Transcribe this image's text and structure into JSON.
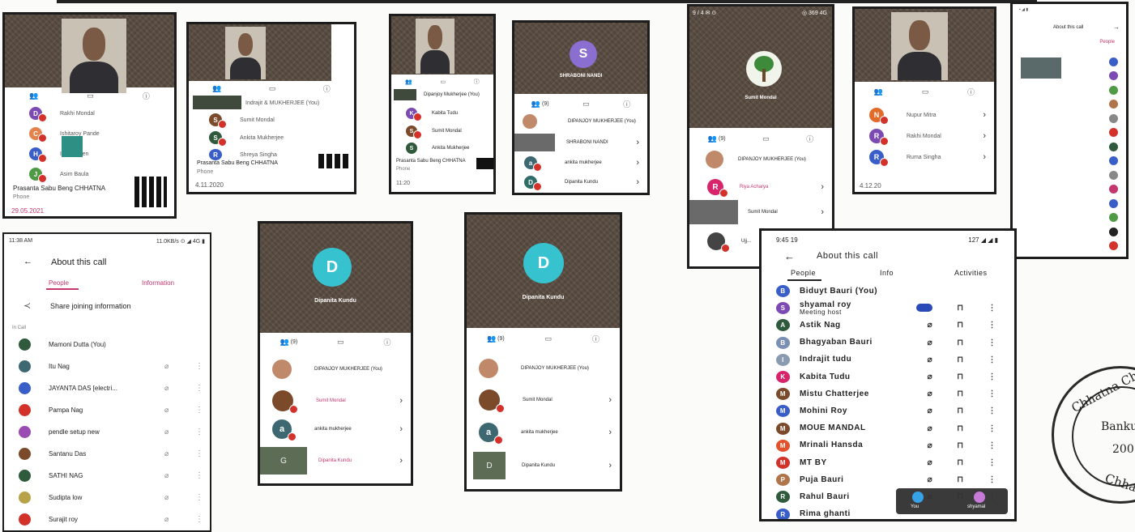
{
  "shot1": {
    "caller": "Prasanta Sabu Beng CHHATNA",
    "type": "Phone",
    "date": "29.05.2021",
    "rows": [
      {
        "name": "Rakhi Mondal",
        "letter": "D",
        "color": "#7b4ab3"
      },
      {
        "name": "Ishitaroy Pande",
        "letter": "C",
        "color": "#e3824a"
      },
      {
        "name": "Indrajit Sen",
        "letter": "H",
        "color": "#3a5ec8"
      },
      {
        "name": "Asim Baula",
        "letter": "J",
        "color": "#4f9a44"
      }
    ]
  },
  "shot2": {
    "caller": "Prasanta Sabu Beng CHHATNA",
    "type": "Phone",
    "date": "4.11.2020",
    "rows": [
      {
        "name": "Indrajit & MUKHERJEE (You)",
        "letter": "",
        "color": "#888"
      },
      {
        "name": "Sumit Mondal",
        "letter": "S",
        "color": "#7a4a2a"
      },
      {
        "name": "Ankita Mukherjee",
        "letter": "S",
        "color": "#2f5a3c"
      },
      {
        "name": "Shreya Singha",
        "letter": "R",
        "color": "#3a5ec8"
      }
    ]
  },
  "shot3": {
    "caller": "Prasanta Sabu Beng CHHATNA",
    "type": "Phone",
    "date": "11:20",
    "rows": [
      {
        "name": "Dipanjoy Mukherjee (You)",
        "letter": "",
        "color": "#888"
      },
      {
        "name": "Kabita Tudu",
        "letter": "K",
        "color": "#7b4ab3"
      },
      {
        "name": "Sumit Mondal",
        "letter": "S",
        "color": "#7a4a2a"
      },
      {
        "name": "Ankita Mukherjee",
        "letter": "S",
        "color": "#2f5a3c"
      }
    ]
  },
  "shot4": {
    "avatar": "S",
    "name": "SHRABONI NANDI",
    "count": "(9)",
    "rows": [
      {
        "name": "DIPANJOY MUKHERJEE (You)",
        "letter": "",
        "color": "#888"
      },
      {
        "name": "SHRABONI NANDI",
        "letter": "",
        "color": "#6a6a6a"
      },
      {
        "name": "ankita mukherjee",
        "letter": "a",
        "color": "#3d6872"
      },
      {
        "name": "Dipanita Kundu",
        "letter": "D",
        "color": "#2e6d6a"
      }
    ]
  },
  "shot5": {
    "status": "9 / 4 ✉ ⊙",
    "status_right": "◎ 369 4G",
    "name": "Sumit Mondal",
    "count": "(9)",
    "rows": [
      {
        "name": "DIPANJOY MUKHERJEE (You)",
        "letter": "",
        "color": "#888"
      },
      {
        "name": "Riya Acharya",
        "letter": "R",
        "color": "#d8246a"
      },
      {
        "name": "Sumit Mondal",
        "letter": "",
        "color": "#6a6a6a"
      },
      {
        "name": "Ujj...",
        "letter": "",
        "color": "#444"
      }
    ]
  },
  "shot6": {
    "date": "4.12.20",
    "rows": [
      {
        "name": "Nupur Mitra",
        "letter": "N",
        "color": "#e36b2a"
      },
      {
        "name": "Rakhi Mondal",
        "letter": "R",
        "color": "#7b4ab3"
      },
      {
        "name": "Ruma Singha",
        "letter": "R",
        "color": "#3a5ec8"
      }
    ]
  },
  "shot7": {
    "title": "About this call",
    "tab": "People",
    "rows": [
      "Biduyt Bauri (You)",
      "shyamal roy",
      "Astik Nag",
      "Bhagyaban Bauri",
      "Indrajit tudu",
      "Kabita Tudu",
      "Mistu Chatterjee",
      "Mohini Roy",
      "MOUE MANDAL",
      "Mrinali Hansda",
      "MT BY",
      "Puja Bauri",
      "Rahul Bauri"
    ]
  },
  "shot8": {
    "status_left": "11:38 AM",
    "status_right": "11.0KB/s ⊙ ◢ 4G ▮",
    "title": "About this call",
    "tab_people": "People",
    "tab_info": "Information",
    "share": "Share joining information",
    "section": "In Call",
    "rows": [
      {
        "name": "Mamoni Dutta (You)",
        "color": "#2f5a3c"
      },
      {
        "name": "Itu Nag",
        "color": "#3d6872"
      },
      {
        "name": "JAYANTA DAS [electri...",
        "color": "#3a5ec8"
      },
      {
        "name": "Pampa Nag",
        "color": "#d3322b"
      },
      {
        "name": "pendle setup new",
        "color": "#9a4ab3"
      },
      {
        "name": "Santanu Das",
        "color": "#7a4a2a"
      },
      {
        "name": "SATHI NAG",
        "color": "#2f5a3c"
      },
      {
        "name": "Sudipta low",
        "color": "#b7a24a"
      },
      {
        "name": "Surajit roy",
        "color": "#d3322b"
      }
    ]
  },
  "shot9": {
    "avatar": "D",
    "name": "Dipanita Kundu",
    "count": "(9)",
    "rows": [
      {
        "name": "DIPANJOY MUKHERJEE (You)",
        "letter": "",
        "color": "#888"
      },
      {
        "name": "Sumit Mondal",
        "letter": "",
        "color": "#7a4a2a"
      },
      {
        "name": "ankita mukherjee",
        "letter": "a",
        "color": "#3d6872"
      },
      {
        "name": "Dipanita Kundu",
        "letter": "G",
        "color": "#5d6d55"
      }
    ]
  },
  "shot10": {
    "avatar": "D",
    "name": "Dipanita Kundu",
    "count": "(9)",
    "rows": [
      {
        "name": "DIPANJOY MUKHERJEE (You)",
        "letter": "",
        "color": "#888"
      },
      {
        "name": "Sumit Mondal",
        "letter": "",
        "color": "#7a4a2a"
      },
      {
        "name": "ankita mukherjee",
        "letter": "a",
        "color": "#3d6872"
      },
      {
        "name": "Dipanita Kundu",
        "letter": "D",
        "color": "#5d6d55"
      }
    ]
  },
  "shot11": {
    "status_left": "9:45 19",
    "status_right": "127 ◢ ◢ ▮",
    "title": "About this call",
    "tab_people": "People",
    "tab_info": "Info",
    "tab_activities": "Activities",
    "rows": [
      {
        "name": "Biduyt Bauri (You)",
        "sub": "",
        "letter": "B",
        "color": "#3a5ec8"
      },
      {
        "name": "shyamal roy",
        "sub": "Meeting host",
        "letter": "S",
        "color": "#7b4ab3"
      },
      {
        "name": "Astik Nag",
        "sub": "",
        "letter": "A",
        "color": "#2f5a3c"
      },
      {
        "name": "Bhagyaban Bauri",
        "sub": "",
        "letter": "B",
        "color": "#7a8fb3"
      },
      {
        "name": "Indrajit tudu",
        "sub": "",
        "letter": "I",
        "color": "#8a9ab0"
      },
      {
        "name": "Kabita Tudu",
        "sub": "",
        "letter": "K",
        "color": "#d8246a"
      },
      {
        "name": "Mistu Chatterjee",
        "sub": "",
        "letter": "M",
        "color": "#7a4a2a"
      },
      {
        "name": "Mohini Roy",
        "sub": "",
        "letter": "M",
        "color": "#3a5ec8"
      },
      {
        "name": "MOUE MANDAL",
        "sub": "",
        "letter": "M",
        "color": "#7a4a2a"
      },
      {
        "name": "Mrinali Hansda",
        "sub": "",
        "letter": "M",
        "color": "#e3522a"
      },
      {
        "name": "MT BY",
        "sub": "",
        "letter": "M",
        "color": "#d3322b"
      },
      {
        "name": "Puja Bauri",
        "sub": "",
        "letter": "P",
        "color": "#b0744a"
      },
      {
        "name": "Rahul Bauri",
        "sub": "",
        "letter": "R",
        "color": "#2f5a3c"
      },
      {
        "name": "Rima ghanti",
        "sub": "",
        "letter": "R",
        "color": "#3a5ec8"
      }
    ],
    "pip_you": "You",
    "pip_other": "shyamal"
  },
  "stamp": {
    "text_top": "Chhatna Chandidas",
    "text_mid": "Bankura",
    "text_year": "200",
    "text_bottom": "Chhatna"
  }
}
